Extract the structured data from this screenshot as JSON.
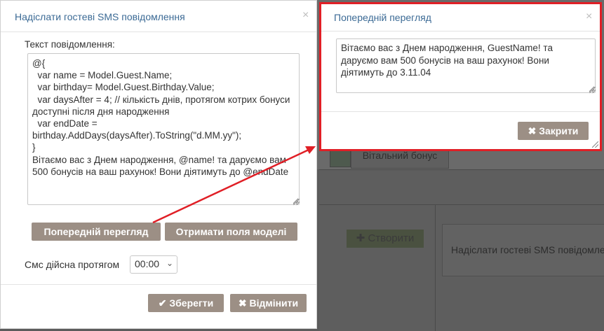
{
  "left_modal": {
    "title": "Надіслати гостеві SMS повідомлення",
    "close_glyph": "×",
    "message_label": "Текст повідомлення:",
    "message_text": "@{\n  var name = Model.Guest.Name;\n  var birthday= Model.Guest.Birthday.Value;\n  var daysAfter = 4; // кількість днів, протягом котрих бонуси доступні після дня народження\n  var endDate = birthday.AddDays(daysAfter).ToString(\"d.MM.yy\");\n}\nВітаємо вас з Днем народження, @name! та даруємо вам 500 бонусів на ваш рахунок! Вони діятимуть до @endDate",
    "preview_button": "Попередній перегляд",
    "model_fields_button": "Отримати поля моделі",
    "validity_label": "Смс дійсна протягом",
    "validity_value": "00:00",
    "save_button": "Зберегти",
    "cancel_button": "Відмінити"
  },
  "right_modal": {
    "title": "Попередній перегляд",
    "close_glyph": "×",
    "preview_text": "Вітаємо вас з Днем народження, GuestName! та даруємо вам 500 бонусів на ваш рахунок! Вони діятимуть до 3.11.04",
    "close_button": "Закрити"
  },
  "background": {
    "tab_label": "Вітальний бонус",
    "create_button": "Створити",
    "card_text": "Надіслати гостеві SMS повідомле"
  },
  "icons": {
    "check": "check-icon",
    "cross": "times-icon",
    "plus": "plus-icon",
    "chevron": "chevron-down-icon"
  },
  "colors": {
    "title_blue": "#3b6a95",
    "button_gray": "#9c8f85",
    "highlight_red": "#e01f26"
  }
}
